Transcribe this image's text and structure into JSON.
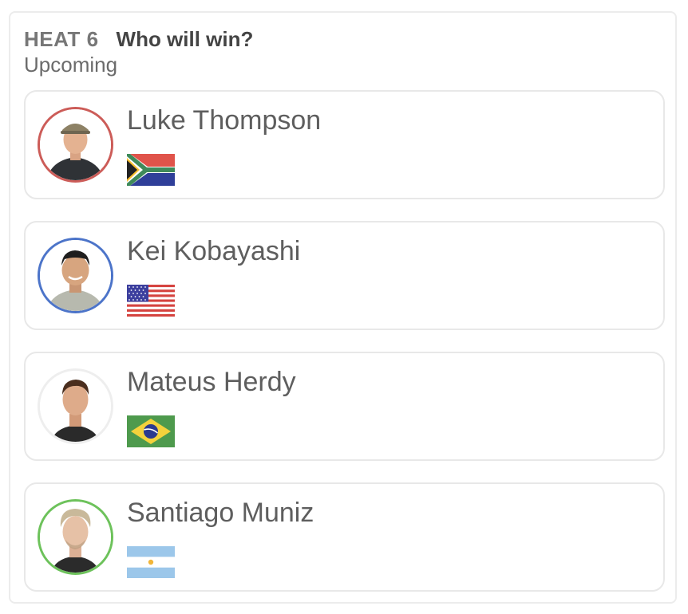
{
  "heat": {
    "label": "HEAT 6",
    "question": "Who will win?",
    "status": "Upcoming"
  },
  "surfers": [
    {
      "name": "Luke Thompson",
      "flag": "south-africa-flag",
      "ring_color": "#cc5c58",
      "avatar_icon": "surfer-photo"
    },
    {
      "name": "Kei Kobayashi",
      "flag": "usa-flag",
      "ring_color": "#4c74c9",
      "avatar_icon": "surfer-photo"
    },
    {
      "name": "Mateus Herdy",
      "flag": "brazil-flag",
      "ring_color": "#eeeeee",
      "avatar_icon": "surfer-photo"
    },
    {
      "name": "Santiago Muniz",
      "flag": "argentina-flag",
      "ring_color": "#6dc25b",
      "avatar_icon": "surfer-photo"
    }
  ]
}
